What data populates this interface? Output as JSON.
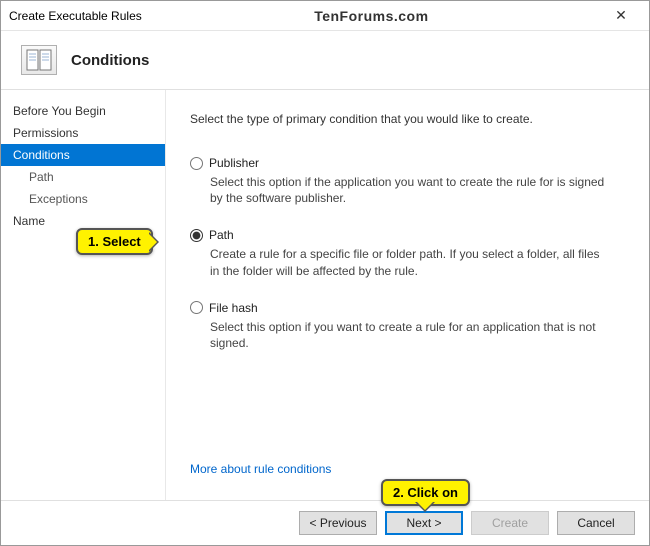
{
  "titlebar": {
    "title": "Create Executable Rules",
    "watermark": "TenForums.com",
    "close_glyph": "✕"
  },
  "header": {
    "title": "Conditions"
  },
  "sidebar": {
    "items": [
      {
        "label": "Before You Begin",
        "selected": false,
        "indent": false
      },
      {
        "label": "Permissions",
        "selected": false,
        "indent": false
      },
      {
        "label": "Conditions",
        "selected": true,
        "indent": false
      },
      {
        "label": "Path",
        "selected": false,
        "indent": true
      },
      {
        "label": "Exceptions",
        "selected": false,
        "indent": true
      },
      {
        "label": "Name",
        "selected": false,
        "indent": false
      }
    ]
  },
  "main": {
    "intro": "Select the type of primary condition that you would like to create.",
    "options": [
      {
        "key": "publisher",
        "label": "Publisher",
        "checked": false,
        "desc": "Select this option if the application you want to create the rule for is signed by the software publisher."
      },
      {
        "key": "path",
        "label": "Path",
        "checked": true,
        "desc": "Create a rule for a specific file or folder path. If you select a folder, all files in the folder will be affected by the rule."
      },
      {
        "key": "filehash",
        "label": "File hash",
        "checked": false,
        "desc": "Select this option if you want to create a rule for an application that is not signed."
      }
    ],
    "more_link": "More about rule conditions"
  },
  "footer": {
    "previous": "< Previous",
    "next": "Next >",
    "create": "Create",
    "cancel": "Cancel"
  },
  "annotations": {
    "select": "1. Select",
    "click_on": "2. Click on"
  }
}
